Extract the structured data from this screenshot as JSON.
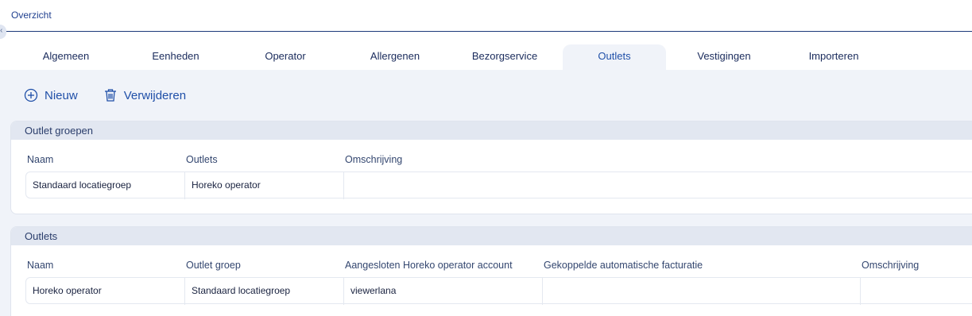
{
  "breadcrumb": "Overzicht",
  "tabs": [
    "Algemeen",
    "Eenheden",
    "Operator",
    "Allergenen",
    "Bezorgservice",
    "Outlets",
    "Vestigingen",
    "Importeren"
  ],
  "active_tab": "Outlets",
  "toolbar": {
    "new_label": "Nieuw",
    "delete_label": "Verwijderen"
  },
  "outlet_groups": {
    "title": "Outlet groepen",
    "columns": [
      "Naam",
      "Outlets",
      "Omschrijving"
    ],
    "rows": [
      [
        "Standaard locatiegroep",
        "Horeko operator",
        ""
      ]
    ]
  },
  "outlets": {
    "title": "Outlets",
    "columns": [
      "Naam",
      "Outlet groep",
      "Aangesloten Horeko operator account",
      "Gekoppelde automatische facturatie",
      "Omschrijving"
    ],
    "rows": [
      [
        "Horeko operator",
        "Standaard locatiegroep",
        "viewerlana",
        "",
        ""
      ]
    ]
  },
  "colors": {
    "accent": "#1f4fa8",
    "panel_header": "#e2e7f1",
    "content_bg": "#f0f3f9"
  }
}
